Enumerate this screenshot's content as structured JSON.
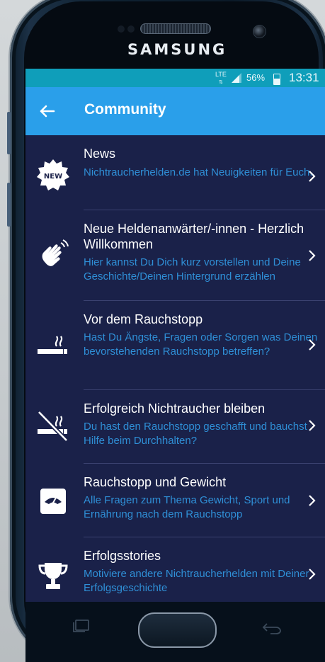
{
  "device": {
    "brand": "SAMSUNG"
  },
  "status_bar": {
    "network": "LTE",
    "battery_percent": "56%",
    "battery_level": 0.56,
    "time": "13:31"
  },
  "app_bar": {
    "title": "Community",
    "back_icon": "arrow-left-icon"
  },
  "topics": [
    {
      "icon": "new-badge-icon",
      "title": "News",
      "desc": "Nichtraucherhelden.de hat Neuigkeiten für Euch."
    },
    {
      "icon": "waving-hand-icon",
      "title": "Neue Heldenanwärter/-innen - Herzlich Willkommen",
      "desc": "Hier kannst Du Dich kurz vorstellen und Deine Geschichte/Deinen Hintergrund erzählen"
    },
    {
      "icon": "cigarette-icon",
      "title": "Vor dem Rauchstopp",
      "desc": "Hast Du Ängste, Fragen oder Sorgen was Deinen bevorstehenden Rauchstopp betreffen?"
    },
    {
      "icon": "no-smoking-icon",
      "title": "Erfolgreich Nichtraucher bleiben",
      "desc": "Du hast den Rauchstopp geschafft und bauchst Hilfe beim Durchhalten?"
    },
    {
      "icon": "scale-icon",
      "title": "Rauchstopp und Gewicht",
      "desc": "Alle Fragen zum Thema Gewicht, Sport und Ernährung nach dem Rauchstopp"
    },
    {
      "icon": "trophy-icon",
      "title": "Erfolgsstories",
      "desc": "Motiviere andere Nichtraucherhelden mit Deiner Erfolgsgeschichte"
    }
  ],
  "colors": {
    "status_bar": "#0f9eba",
    "app_bar": "#2a9fea",
    "list_background": "#1a2149",
    "description_text": "#2f8fd6"
  }
}
